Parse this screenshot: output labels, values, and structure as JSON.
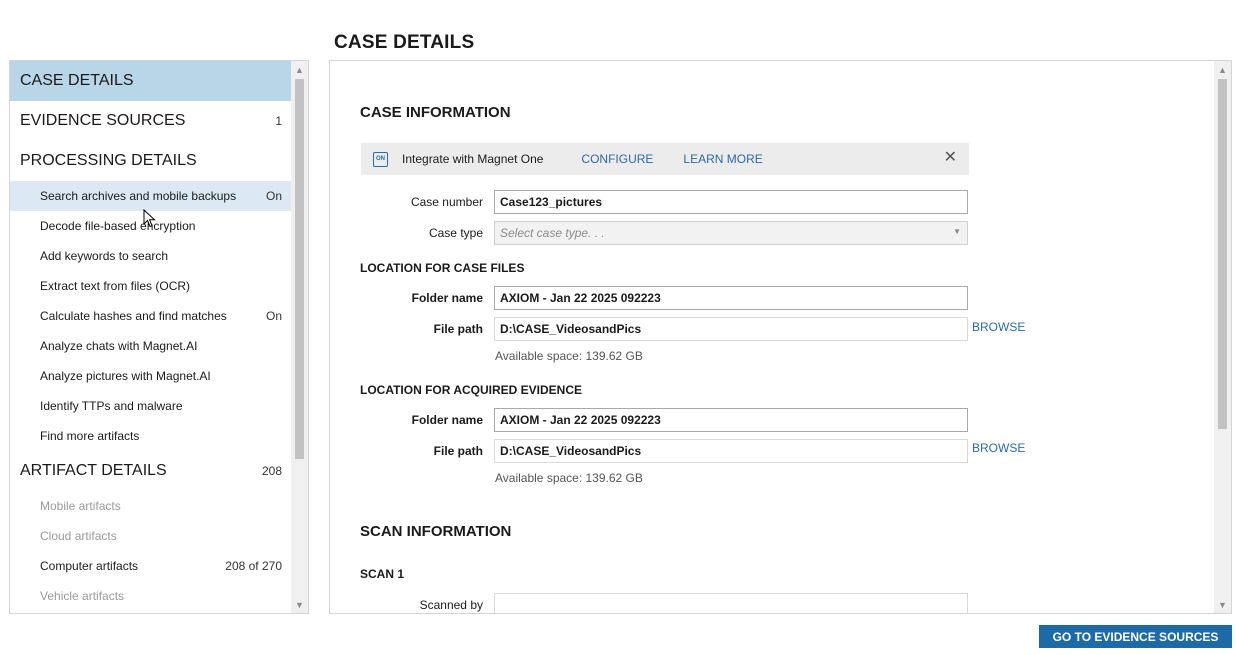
{
  "page_title": "CASE DETAILS",
  "nav": {
    "sections": [
      {
        "label": "CASE DETAILS",
        "count": ""
      },
      {
        "label": "EVIDENCE SOURCES",
        "count": "1"
      },
      {
        "label": "PROCESSING DETAILS",
        "count": ""
      },
      {
        "label": "ARTIFACT DETAILS",
        "count": "208"
      }
    ],
    "processing_items": [
      {
        "label": "Search archives and mobile backups",
        "status": "On"
      },
      {
        "label": "Decode file-based encryption",
        "status": ""
      },
      {
        "label": "Add keywords to search",
        "status": ""
      },
      {
        "label": "Extract text from files (OCR)",
        "status": ""
      },
      {
        "label": "Calculate hashes and find matches",
        "status": "On"
      },
      {
        "label": "Analyze chats with Magnet.AI",
        "status": ""
      },
      {
        "label": "Analyze pictures with Magnet.AI",
        "status": ""
      },
      {
        "label": "Identify TTPs and malware",
        "status": ""
      },
      {
        "label": "Find more artifacts",
        "status": ""
      }
    ],
    "artifact_items": [
      {
        "label": "Mobile artifacts",
        "count": ""
      },
      {
        "label": "Cloud artifacts",
        "count": ""
      },
      {
        "label": "Computer artifacts",
        "count": "208 of 270"
      },
      {
        "label": "Vehicle artifacts",
        "count": ""
      }
    ]
  },
  "case_information": {
    "heading": "CASE INFORMATION",
    "banner": {
      "text": "Integrate with Magnet One",
      "logo_text": "ON",
      "configure": "CONFIGURE",
      "learn_more": "LEARN MORE",
      "close_glyph": "✕"
    },
    "case_number_label": "Case number",
    "case_number_value": "Case123_pictures",
    "case_type_label": "Case type",
    "case_type_placeholder": "Select case type. . ."
  },
  "case_files": {
    "heading": "LOCATION FOR CASE FILES",
    "folder_label": "Folder name",
    "folder_value": "AXIOM - Jan 22 2025 092223",
    "path_label": "File path",
    "path_value": "D:\\CASE_VideosandPics",
    "browse": "BROWSE",
    "available": "Available space: 139.62 GB"
  },
  "acquired_evidence": {
    "heading": "LOCATION FOR ACQUIRED EVIDENCE",
    "folder_label": "Folder name",
    "folder_value": "AXIOM - Jan 22 2025 092223",
    "path_label": "File path",
    "path_value": "D:\\CASE_VideosandPics",
    "browse": "BROWSE",
    "available": "Available space: 139.62 GB"
  },
  "scan_information": {
    "heading": "SCAN INFORMATION",
    "scan_heading": "SCAN 1",
    "scanned_by_label": "Scanned by"
  },
  "footer": {
    "go_button": "GO TO EVIDENCE SOURCES"
  },
  "colors": {
    "accent": "#1d6aa8",
    "link": "#2c6aa5",
    "selected_nav": "#b9d5e8"
  }
}
